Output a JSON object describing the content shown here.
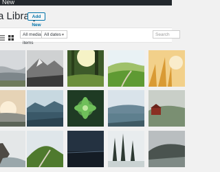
{
  "adminbar": {
    "new_label": "New"
  },
  "header": {
    "title": "a Library",
    "add_new_label": "Add New"
  },
  "filters": {
    "type_label": "All media items",
    "date_label": "All dates",
    "search_placeholder": "Search"
  },
  "media": [
    {
      "name": "foggy-hills"
    },
    {
      "name": "snow-mountain-bw"
    },
    {
      "name": "sunlit-forest"
    },
    {
      "name": "green-hills-path"
    },
    {
      "name": "golden-grass"
    },
    {
      "name": "misty-sunrise"
    },
    {
      "name": "mountain-lake"
    },
    {
      "name": "succulent-plant"
    },
    {
      "name": "coastal-lake"
    },
    {
      "name": "red-barn-fog"
    },
    {
      "name": "sea-rocks"
    },
    {
      "name": "green-hill-road"
    },
    {
      "name": "dark-horizon"
    },
    {
      "name": "misty-pines"
    },
    {
      "name": "misty-cliff"
    }
  ]
}
